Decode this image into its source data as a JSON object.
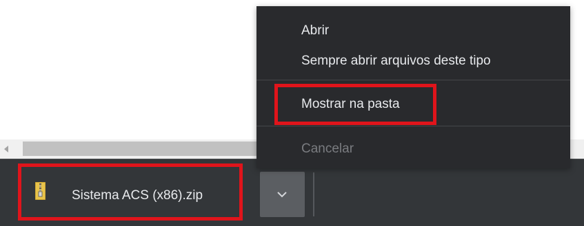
{
  "scrollbar": {},
  "download_shelf": {
    "item": {
      "filename": "Sistema ACS (x86).zip",
      "icon": "zip-archive-icon"
    },
    "dropdown_icon": "chevron-down-icon"
  },
  "context_menu": {
    "items": [
      {
        "label": "Abrir",
        "enabled": true
      },
      {
        "label": "Sempre abrir arquivos deste tipo",
        "enabled": true
      },
      {
        "label": "Mostrar na pasta",
        "enabled": true,
        "highlighted": true
      },
      {
        "label": "Cancelar",
        "enabled": false
      }
    ]
  },
  "colors": {
    "highlight": "#e0141b",
    "menu_bg": "#292a2d",
    "shelf_bg": "#333639",
    "text": "#e8eaed",
    "disabled_text": "#7a7c80"
  }
}
